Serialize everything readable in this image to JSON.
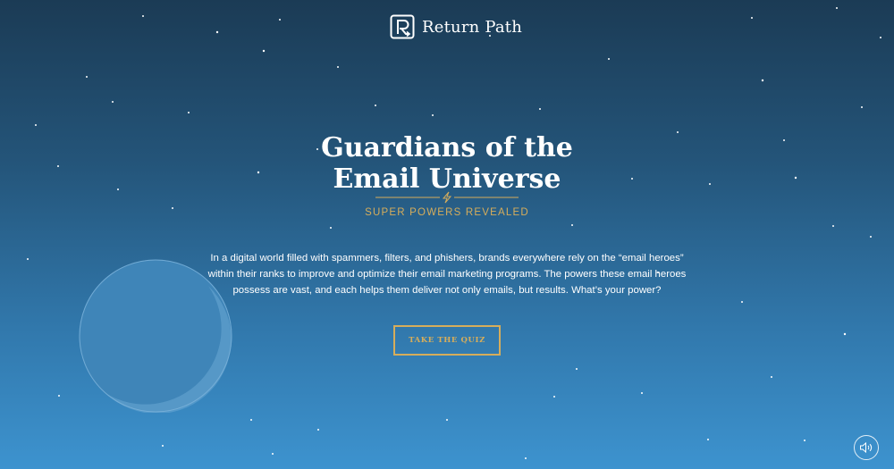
{
  "brand": {
    "name": "Return Path",
    "icon": "return-path-logo-icon"
  },
  "hero": {
    "title_line1": "Guardians of the",
    "title_line2": "Email Universe",
    "divider_icon": "lightning-bolt-icon",
    "subtitle": "SUPER POWERS REVEALED",
    "intro": "In a digital world filled with spammers, filters, and phishers, brands everywhere rely on the “email heroes” within their ranks to improve and optimize their email marketing programs. The powers these email heroes possess are vast, and each helps them deliver not only emails, but results. What’s your power?"
  },
  "cta": {
    "label": "TAKE THE QUIZ"
  },
  "controls": {
    "sound_icon": "speaker-icon"
  },
  "colors": {
    "sky_top": "#1b3b55",
    "sky_bottom": "#3d93cf",
    "accent_gold": "#d6ad5b",
    "text": "#ffffff"
  }
}
